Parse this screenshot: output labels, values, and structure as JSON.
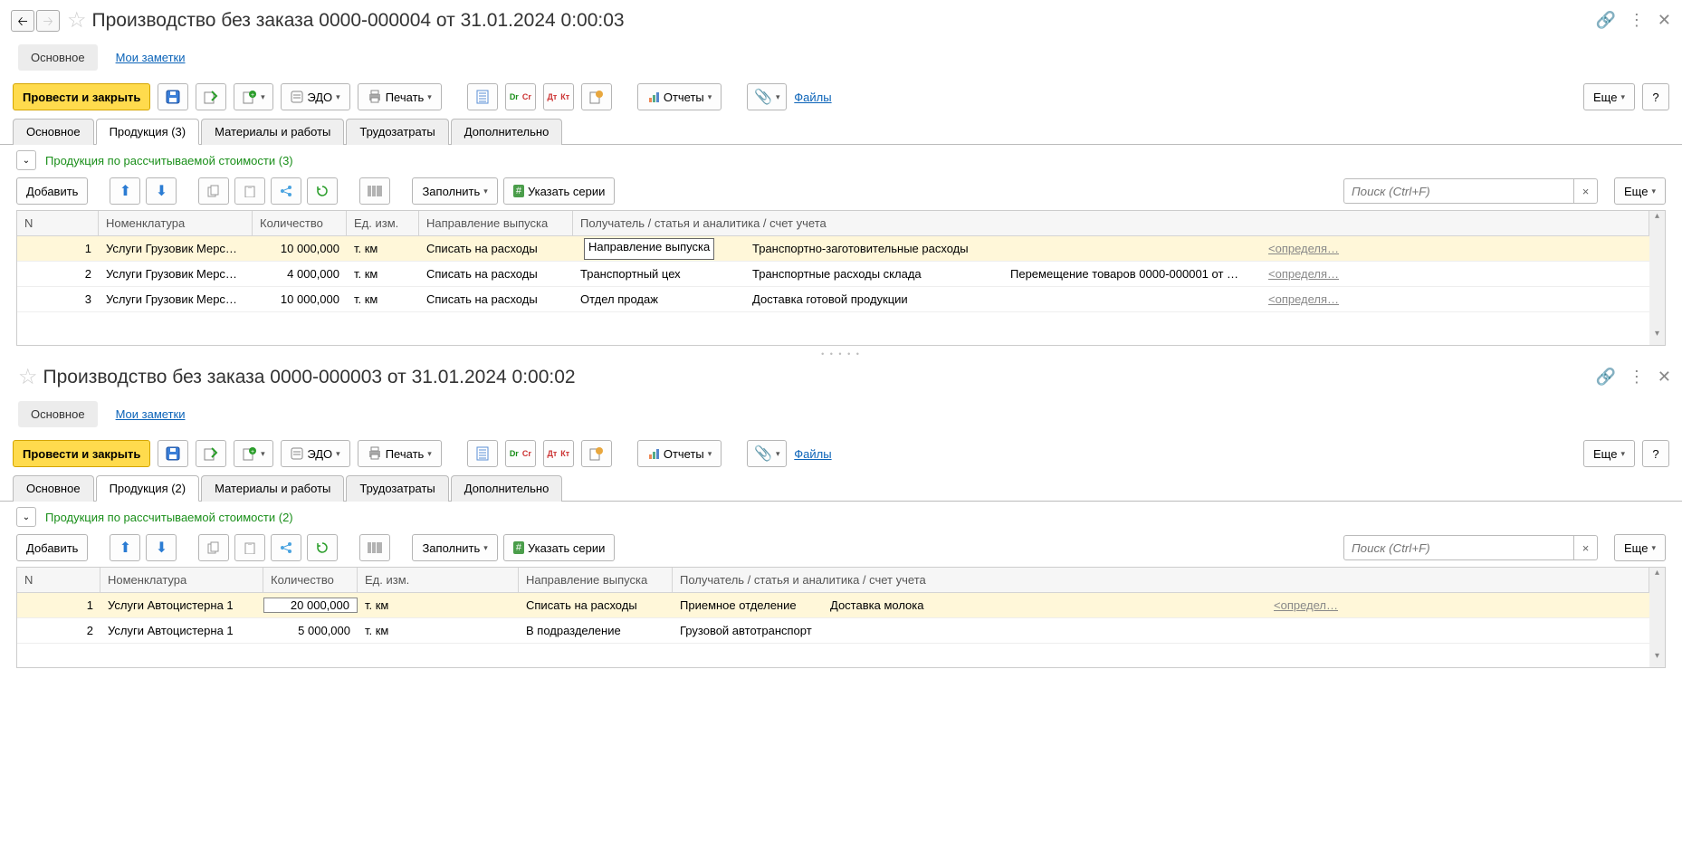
{
  "common": {
    "nav_main": "Основное",
    "nav_notes": "Мои заметки",
    "btn_post_close": "Провести и закрыть",
    "btn_edo": "ЭДО",
    "btn_print": "Печать",
    "btn_reports": "Отчеты",
    "link_files": "Файлы",
    "btn_more": "Еще",
    "btn_help": "?",
    "tab_main": "Основное",
    "tab_mat": "Материалы и работы",
    "tab_labor": "Трудозатраты",
    "tab_add": "Дополнительно",
    "btn_add": "Добавить",
    "btn_fill": "Заполнить",
    "btn_series": "Указать серии",
    "search_ph": "Поиск (Ctrl+F)",
    "col_n": "N",
    "col_nom": "Номенклатура",
    "col_qty": "Количество",
    "col_unit": "Ед. изм.",
    "col_dir": "Направление выпуска",
    "col_rcv": "Получатель / статья и аналитика / счет учета",
    "acct_placeholder": "<определя…",
    "acct_placeholder2": "<определ…"
  },
  "pane1": {
    "title": "Производство без заказа 0000-000004 от 31.01.2024 0:00:03",
    "tab_prod": "Продукция (3)",
    "section": "Продукция по рассчитываемой стоимости (3)",
    "rows": [
      {
        "n": "1",
        "nom": "Услуги Грузовик Мерс…",
        "qty": "10 000,000",
        "unit": "т. км",
        "dir": "Списать на расходы",
        "rcv": "Направление выпуска",
        "art": "Транспортно-заготовительные расходы",
        "art2": ""
      },
      {
        "n": "2",
        "nom": "Услуги Грузовик Мерс…",
        "qty": "4 000,000",
        "unit": "т. км",
        "dir": "Списать на расходы",
        "rcv": "Транспортный цех",
        "art": "Транспортные  расходы  склада",
        "art2": "Перемещение товаров 0000-000001 от …"
      },
      {
        "n": "3",
        "nom": "Услуги Грузовик Мерс…",
        "qty": "10 000,000",
        "unit": "т. км",
        "dir": "Списать на расходы",
        "rcv": "Отдел продаж",
        "art": "Доставка готовой продукции",
        "art2": ""
      }
    ]
  },
  "pane2": {
    "title": "Производство без заказа 0000-000003 от 31.01.2024 0:00:02",
    "tab_prod": "Продукция (2)",
    "section": "Продукция по рассчитываемой стоимости (2)",
    "rows": [
      {
        "n": "1",
        "nom": "Услуги Автоцистерна 1",
        "qty": "20 000,000",
        "unit": "т. км",
        "dir": "Списать на расходы",
        "rcv": "Приемное отделение",
        "art": "Доставка молока",
        "art2": ""
      },
      {
        "n": "2",
        "nom": "Услуги Автоцистерна 1",
        "qty": "5 000,000",
        "unit": "т. км",
        "dir": "В подразделение",
        "rcv": "Грузовой автотранспорт",
        "art": "",
        "art2": ""
      }
    ]
  }
}
